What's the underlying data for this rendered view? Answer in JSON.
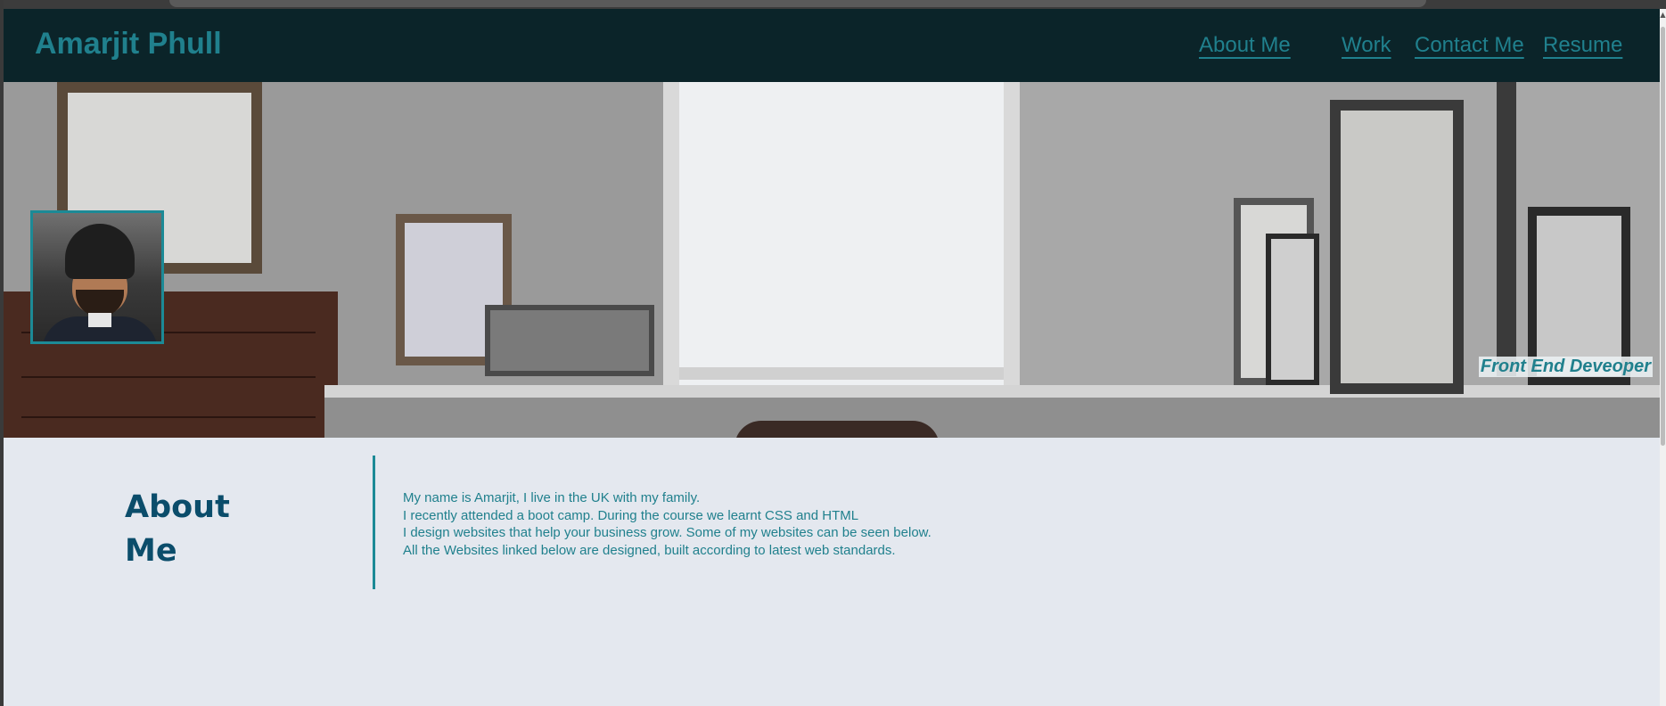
{
  "header": {
    "brand": "Amarjit Phull",
    "nav": [
      {
        "label": "About Me"
      },
      {
        "label": "Work"
      },
      {
        "label": "Contact Me"
      },
      {
        "label": "Resume"
      }
    ]
  },
  "hero": {
    "tagline": "Front End Deveoper"
  },
  "about": {
    "heading_line1": "About",
    "heading_line2": "Me",
    "paragraphs": [
      "My name is Amarjit, I live in the UK with my family.",
      "I recently attended a boot camp. During the course we learnt CSS and HTML",
      "I design websites that help your business grow. Some of my websites can be seen below.",
      "All the Websites linked below are designed, built according to latest web standards."
    ]
  },
  "colors": {
    "header_bg": "#0b2429",
    "accent": "#20808d",
    "heading": "#0b4d6b",
    "page_bg": "#e4e8ef"
  },
  "icons": {
    "scroll_up": "▲"
  }
}
